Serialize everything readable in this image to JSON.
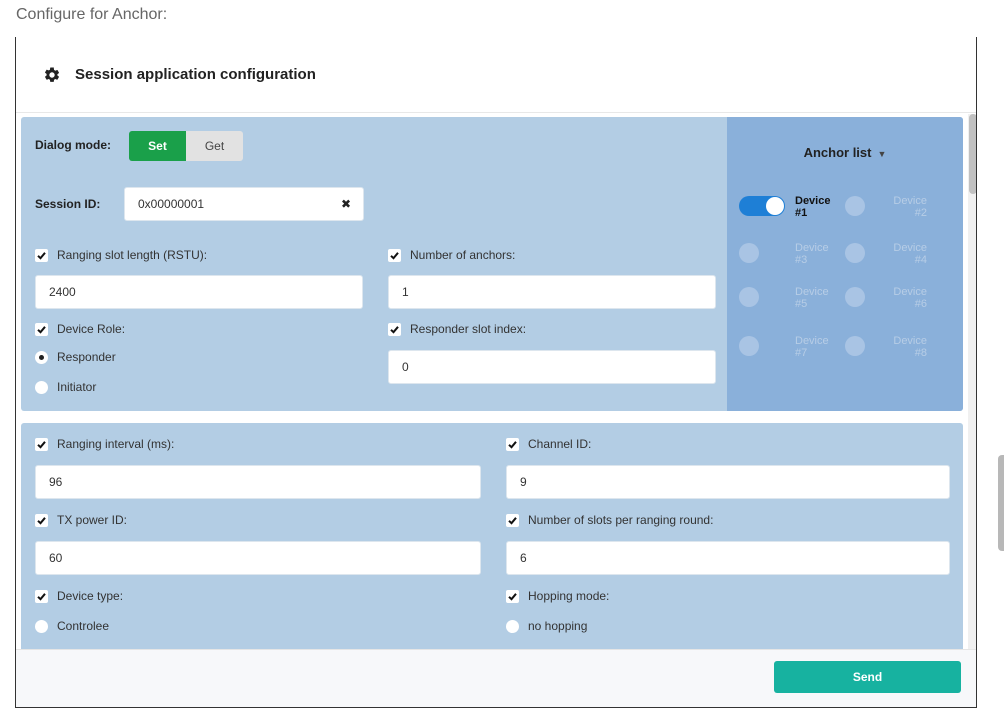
{
  "caption": "Configure for Anchor:",
  "dialog": {
    "icon": "gear-icon",
    "title": "Session application configuration"
  },
  "session": {
    "dialog_mode_label": "Dialog mode:",
    "mode_options": [
      "Set",
      "Get"
    ],
    "mode_selected": "Set",
    "session_id_label": "Session ID:",
    "session_id_value": "0x00000001",
    "clear_glyph": "✖",
    "ranging_slot_label": "Ranging slot length (RSTU):",
    "ranging_slot_value": "2400",
    "number_anchors_label": "Number of anchors:",
    "number_anchors_value": "1",
    "device_role_label": "Device Role:",
    "role_options": [
      "Responder",
      "Initiator"
    ],
    "role_selected": "Responder",
    "responder_slot_label": "Responder slot index:",
    "responder_slot_value": "0"
  },
  "anchor_list": {
    "title": "Anchor list",
    "caret": "▼",
    "devices": [
      {
        "line1": "Device",
        "line2": "#1",
        "enabled": true
      },
      {
        "line1": "Device",
        "line2": "#2",
        "enabled": false
      },
      {
        "line1": "Device",
        "line2": "#3",
        "enabled": false
      },
      {
        "line1": "Device",
        "line2": "#4",
        "enabled": false
      },
      {
        "line1": "Device",
        "line2": "#5",
        "enabled": false
      },
      {
        "line1": "Device",
        "line2": "#6",
        "enabled": false
      },
      {
        "line1": "Device",
        "line2": "#7",
        "enabled": false
      },
      {
        "line1": "Device",
        "line2": "#8",
        "enabled": false
      }
    ]
  },
  "ranging": {
    "interval_label": "Ranging interval (ms):",
    "interval_value": "96",
    "channel_label": "Channel ID:",
    "channel_value": "9",
    "tx_power_label": "TX power ID:",
    "tx_power_value": "60",
    "slots_label": "Number of slots per ranging round:",
    "slots_value": "6",
    "device_type_label": "Device type:",
    "device_type_option": "Controlee",
    "hopping_label": "Hopping mode:",
    "hopping_option": "no hopping"
  },
  "footer": {
    "send_label": "Send"
  },
  "colors": {
    "panel_bg": "#b3cde4",
    "anchor_bg": "#8ab0da",
    "set_active": "#1aa04a",
    "toggle_on": "#1e7fd6",
    "send_button": "#17b2a0"
  }
}
